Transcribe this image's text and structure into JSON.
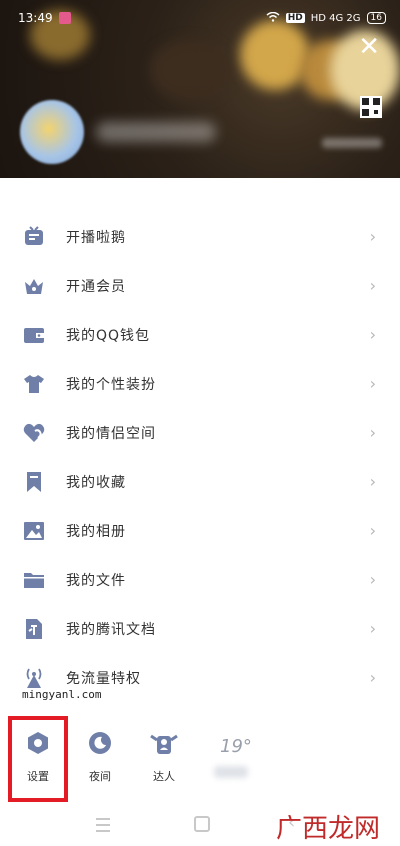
{
  "status_bar": {
    "time": "13:49",
    "right_text": "HD 4G 2G",
    "battery": "16"
  },
  "header": {
    "close_label": "✕",
    "caption": "Pussy and alis"
  },
  "menu": {
    "items": [
      {
        "label": "开播啦鹅",
        "icon": "tv-icon"
      },
      {
        "label": "开通会员",
        "icon": "crown-icon"
      },
      {
        "label": "我的QQ钱包",
        "icon": "wallet-icon"
      },
      {
        "label": "我的个性装扮",
        "icon": "shirt-icon"
      },
      {
        "label": "我的情侣空间",
        "icon": "heart-icon"
      },
      {
        "label": "我的收藏",
        "icon": "bookmark-icon"
      },
      {
        "label": "我的相册",
        "icon": "photo-icon"
      },
      {
        "label": "我的文件",
        "icon": "folder-icon"
      },
      {
        "label": "我的腾讯文档",
        "icon": "document-icon"
      },
      {
        "label": "免流量特权",
        "icon": "antenna-icon"
      }
    ],
    "chevron": "›"
  },
  "watermark": "mingyanl.com",
  "bottom": {
    "settings_label": "设置",
    "night_label": "夜间",
    "expert_label": "达人",
    "temperature": "19°"
  },
  "brand": "广西龙网"
}
